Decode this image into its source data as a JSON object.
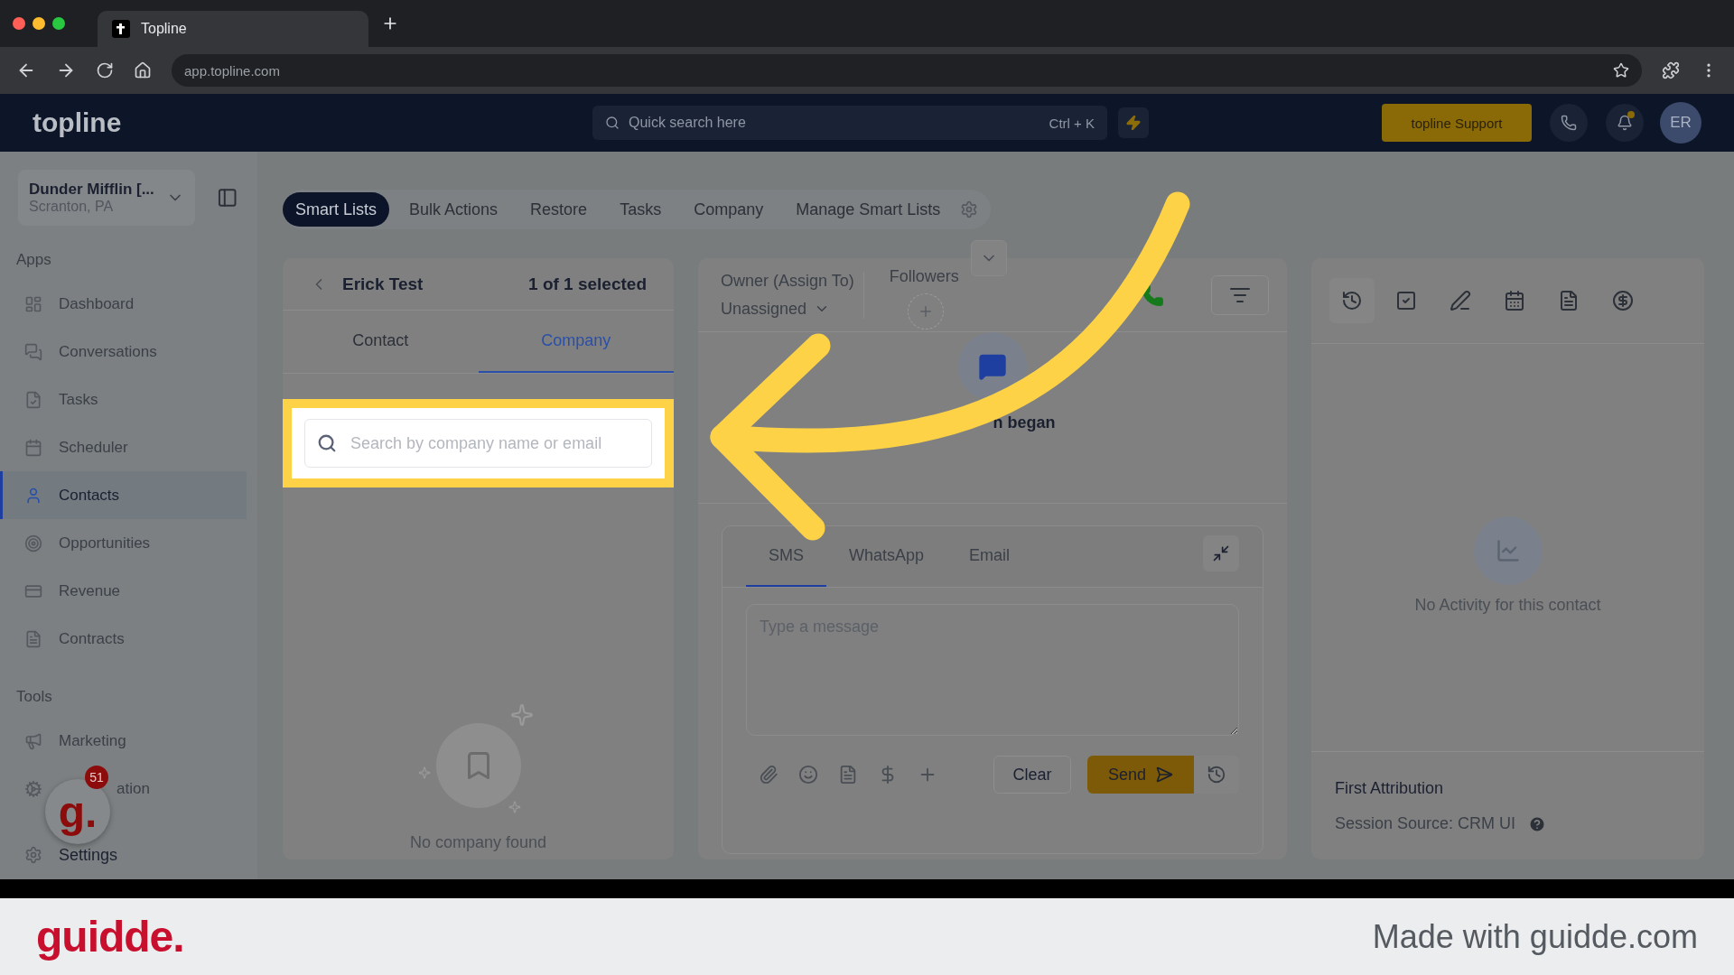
{
  "browser": {
    "tab_title": "Topline",
    "url": "app.topline.com"
  },
  "header": {
    "logo": "topline",
    "search_placeholder": "Quick search here",
    "shortcut": "Ctrl + K",
    "support_button": "topline Support",
    "avatar": "ER"
  },
  "sidebar": {
    "org_name": "Dunder Mifflin [...",
    "org_location": "Scranton, PA",
    "sections": [
      {
        "title": "Apps",
        "items": [
          {
            "label": "Dashboard",
            "selected": false,
            "kind": "plain"
          },
          {
            "label": "Conversations",
            "selected": false,
            "kind": "plain"
          },
          {
            "label": "Tasks",
            "selected": false,
            "kind": "plain"
          },
          {
            "label": "Scheduler",
            "selected": false,
            "kind": "plain"
          },
          {
            "label": "Contacts",
            "selected": true,
            "kind": "plain"
          },
          {
            "label": "Opportunities",
            "selected": false,
            "kind": "plain"
          },
          {
            "label": "Revenue",
            "selected": false,
            "kind": "plain"
          },
          {
            "label": "Contracts",
            "selected": false,
            "kind": "plain"
          }
        ]
      },
      {
        "title": "Tools",
        "items": [
          {
            "label": "Marketing",
            "selected": false,
            "kind": "plain"
          },
          {
            "label": "ation",
            "selected": false,
            "kind": "covered"
          }
        ]
      }
    ],
    "settings": "Settings"
  },
  "guidde_widget": {
    "letter": "g.",
    "count": "51"
  },
  "nav_tabs": [
    {
      "label": "Smart Lists",
      "selected": true
    },
    {
      "label": "Bulk Actions",
      "selected": false
    },
    {
      "label": "Restore",
      "selected": false
    },
    {
      "label": "Tasks",
      "selected": false
    },
    {
      "label": "Company",
      "selected": false
    },
    {
      "label": "Manage Smart Lists",
      "selected": false
    }
  ],
  "contact_panel": {
    "name": "Erick Test",
    "count": "1 of 1 selected",
    "tabs": [
      {
        "label": "Contact",
        "selected": false
      },
      {
        "label": "Company",
        "selected": true
      }
    ],
    "search_placeholder": "Search by company name or email",
    "empty_text": "No company found"
  },
  "conversation": {
    "owner_label": "Owner (Assign To)",
    "owner_value": "Unassigned",
    "followers_label": "Followers",
    "event_text": "n began",
    "composer_tabs": [
      {
        "label": "SMS",
        "selected": true
      },
      {
        "label": "WhatsApp",
        "selected": false
      },
      {
        "label": "Email",
        "selected": false
      }
    ],
    "message_placeholder": "Type a message",
    "clear_button": "Clear",
    "send_button": "Send"
  },
  "activity": {
    "empty_text": "No Activity for this contact",
    "attribution_title": "First Attribution",
    "session_source": "Session Source: CRM UI"
  },
  "footer": {
    "brand": "guidde.",
    "tagline": "Made with guidde.com"
  }
}
